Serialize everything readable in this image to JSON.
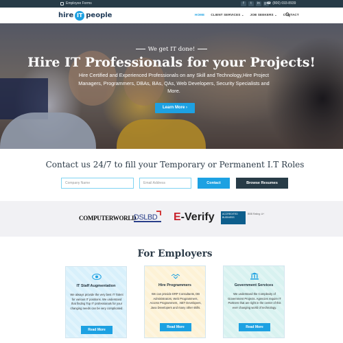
{
  "topbar": {
    "employee_forms": "Employee Forms",
    "socials": [
      "f",
      "t",
      "in",
      "g+"
    ],
    "phone": "(800) 693-8939"
  },
  "nav": {
    "logo_left": "hire",
    "logo_mid": "IT",
    "logo_right": "people",
    "items": [
      {
        "label": "HOME",
        "active": true
      },
      {
        "label": "CLIENT SERVICES",
        "caret": "⌄"
      },
      {
        "label": "JOB SEEKERS",
        "caret": "⌄"
      },
      {
        "label": "CONTACT"
      }
    ],
    "search_icon": "search-icon"
  },
  "hero": {
    "tagline": "We get IT done!",
    "title": "Hire IT Professionals for your Projects!",
    "subtitle": "Hire Certified and Experienced Professionals on any Skill and Technology,Hire Project Managers, Programmers, DBAs, BAs, QAs, Web Developers, Security Specialists and More.",
    "button": "Learn More",
    "button_arrow": "›"
  },
  "contact": {
    "title": "Contact us 24/7 to fill your Temporary or Permanent I.T Roles",
    "company_placeholder": "Company Name",
    "email_placeholder": "Email Address",
    "contact_button": "Contact",
    "browse_button": "Browse Resumes"
  },
  "logos": {
    "computerworld": "COMPUTERWORLD",
    "dslbd": "DSLBD",
    "everify_e": "E",
    "everify_rest": "-Verify",
    "bbb_badge": "ACCREDITED BUSINESS",
    "bbb_text": "BBB Rating: A+"
  },
  "employers": {
    "title": "For Employers",
    "cards": [
      {
        "title": "IT Staff Augmentation",
        "text": "We always provide the very best IT Talent for various IT positions. We understand that finding Top IT professionals for your changing needs can be very complicated.",
        "button": "Read More",
        "icon": "eye-icon"
      },
      {
        "title": "Hire Programmers",
        "text": "We can provide ERP Consultants, DB Administrators, Web Programmers, Access Programmers, .NET Developers, Java Developers and many other skills.",
        "button": "Read More",
        "icon": "handshake-icon"
      },
      {
        "title": "Government Services",
        "text": "We understand the Complexity of Government Projects. Agencies require IT Partners that are right in the center of this ever changing world of technology.",
        "button": "Read More",
        "icon": "government-building-icon"
      }
    ]
  },
  "colors": {
    "accent": "#1da1e2",
    "dark": "#273b47"
  }
}
